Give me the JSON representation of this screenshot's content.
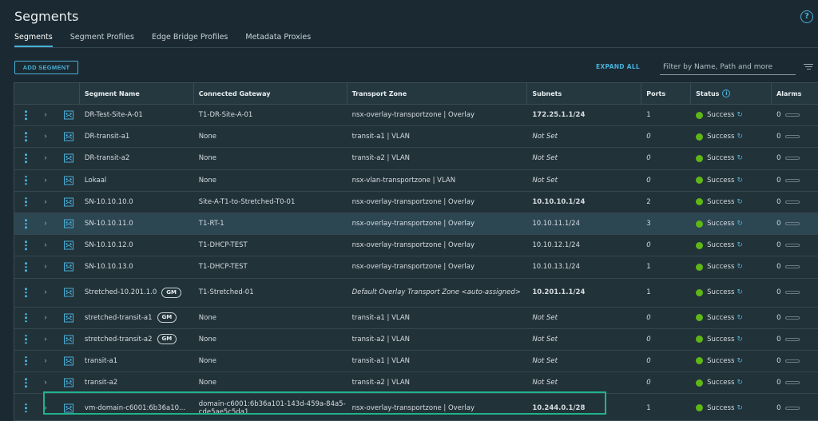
{
  "title": "Segments",
  "tabs": [
    "Segments",
    "Segment Profiles",
    "Edge Bridge Profiles",
    "Metadata Proxies"
  ],
  "toolbar": {
    "add_label": "ADD SEGMENT",
    "expand_all": "EXPAND ALL",
    "filter_placeholder": "Filter by Name, Path and more"
  },
  "columns": [
    "Segment Name",
    "Connected Gateway",
    "Transport Zone",
    "Subnets",
    "Ports",
    "Status",
    "Alarms"
  ],
  "status_label": "Success",
  "rows": [
    {
      "name": "DR-Test-Site-A-01",
      "gm": "",
      "gateway": "T1-DR-Site-A-01",
      "zone": "nsx-overlay-transportzone | Overlay",
      "subnet": "172.25.1.1/24",
      "subnet_style": "bold",
      "ports": "1",
      "alarms": "0"
    },
    {
      "name": "DR-transit-a1",
      "gm": "",
      "gateway": "None",
      "zone": "transit-a1 | VLAN",
      "subnet": "Not Set",
      "subnet_style": "italic",
      "ports": "0",
      "alarms": "0"
    },
    {
      "name": "DR-transit-a2",
      "gm": "",
      "gateway": "None",
      "zone": "transit-a2 | VLAN",
      "subnet": "Not Set",
      "subnet_style": "italic",
      "ports": "0",
      "alarms": "0"
    },
    {
      "name": "Lokaal",
      "gm": "",
      "gateway": "None",
      "zone": "nsx-vlan-transportzone | VLAN",
      "subnet": "Not Set",
      "subnet_style": "italic",
      "ports": "0",
      "alarms": "0"
    },
    {
      "name": "SN-10.10.10.0",
      "gm": "",
      "gateway": "Site-A-T1-to-Stretched-T0-01",
      "zone": "nsx-overlay-transportzone | Overlay",
      "subnet": "10.10.10.1/24",
      "subnet_style": "bold",
      "ports": "2",
      "alarms": "0"
    },
    {
      "name": "SN-10.10.11.0",
      "gm": "",
      "gateway": "T1-RT-1",
      "zone": "nsx-overlay-transportzone | Overlay",
      "subnet": "10.10.11.1/24",
      "subnet_style": "link",
      "ports": "3",
      "alarms": "0"
    },
    {
      "name": "SN-10.10.12.0",
      "gm": "",
      "gateway": "T1-DHCP-TEST",
      "zone": "nsx-overlay-transportzone | Overlay",
      "subnet": "10.10.12.1/24",
      "subnet_style": "link",
      "ports": "0",
      "alarms": "0"
    },
    {
      "name": "SN-10.10.13.0",
      "gm": "",
      "gateway": "T1-DHCP-TEST",
      "zone": "nsx-overlay-transportzone | Overlay",
      "subnet": "10.10.13.1/24",
      "subnet_style": "link",
      "ports": "1",
      "alarms": "0"
    },
    {
      "name": "Stretched-10.201.1.0",
      "gm": "GM",
      "gateway": "T1-Stretched-01",
      "zone": "Default Overlay Transport Zone <auto-assigned>",
      "subnet": "10.201.1.1/24",
      "subnet_style": "bold",
      "ports": "1",
      "alarms": "0"
    },
    {
      "name": "stretched-transit-a1",
      "gm": "GM",
      "gateway": "None",
      "zone": "transit-a1 | VLAN",
      "subnet": "Not Set",
      "subnet_style": "italic",
      "ports": "0",
      "alarms": "0"
    },
    {
      "name": "stretched-transit-a2",
      "gm": "GM",
      "gateway": "None",
      "zone": "transit-a2 | VLAN",
      "subnet": "Not Set",
      "subnet_style": "italic",
      "ports": "0",
      "alarms": "0"
    },
    {
      "name": "transit-a1",
      "gm": "",
      "gateway": "None",
      "zone": "transit-a1 | VLAN",
      "subnet": "Not Set",
      "subnet_style": "italic",
      "ports": "0",
      "alarms": "0"
    },
    {
      "name": "transit-a2",
      "gm": "",
      "gateway": "None",
      "zone": "transit-a2 | VLAN",
      "subnet": "Not Set",
      "subnet_style": "italic",
      "ports": "0",
      "alarms": "0"
    },
    {
      "name": "vm-domain-c6001:6b36a10...",
      "gm": "",
      "gateway": "domain-c6001:6b36a101-143d-459a-84a5-cde5ae5c5da1",
      "zone": "nsx-overlay-transportzone | Overlay",
      "subnet": "10.244.0.1/28",
      "subnet_style": "bold",
      "ports": "1",
      "alarms": "0"
    }
  ],
  "colors": {
    "accent": "#49afd9",
    "success": "#5eb715",
    "selection": "#1fb38a",
    "background": "#1b2a32"
  },
  "icons": {
    "help": "help-circle-icon",
    "row_menu": "kebab-icon",
    "expand": "chevron-right-icon",
    "segment": "segment-icon",
    "refresh": "refresh-icon",
    "filter": "filter-lines-icon",
    "info": "info-icon"
  }
}
